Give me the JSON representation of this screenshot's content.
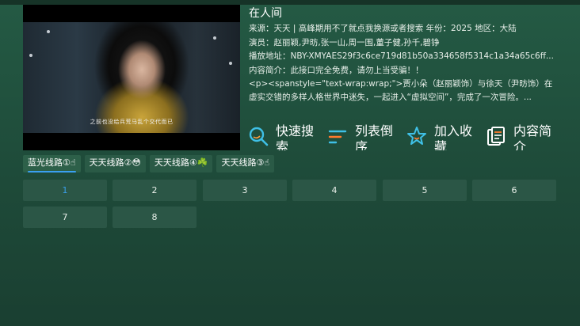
{
  "player": {
    "subtitle": "之前也没给兵荒马乱个交代而已"
  },
  "detail": {
    "title": "在人间",
    "source_line": "来源：天天 | 高峰期用不了就点我换源或者搜索 年份：2025 地区：大陆",
    "actors_line": "演员：赵丽颖,尹昉,张一山,周一围,董子健,孙千,碧铮",
    "play_url_line": "播放地址：NBY-XMYAES29f3c6ce719d81b50a334658f5314c1a34a65c6ff...",
    "intro_line": "内容简介：此接口完全免费，请勿上当受骗！！",
    "description": "<p><spanstyle=\"text-wrap:wrap;\">贾小朵（赵丽颖饰）与徐天（尹昉饰）在虚实交错的多样人格世界中迷失，一起进入“虚拟空间”，完成了一次冒险。..."
  },
  "actions": [
    {
      "label": "快速搜索",
      "icon": "search-icon",
      "color": "#3fc0e6"
    },
    {
      "label": "列表倒序",
      "icon": "sort-list-icon",
      "color": "#3fc0e6"
    },
    {
      "label": "加入收藏",
      "icon": "star-icon",
      "color": "#3fc0e6"
    },
    {
      "label": "内容简介",
      "icon": "document-icon",
      "color": "#ffffff"
    }
  ],
  "lines": [
    {
      "label": "蓝光线路①☝",
      "active": true
    },
    {
      "label": "天天线路②😳",
      "active": false
    },
    {
      "label": "天天线路④☘️",
      "active": false
    },
    {
      "label": "天天线路③☝",
      "active": false
    }
  ],
  "episodes": [
    "1",
    "2",
    "3",
    "4",
    "5",
    "6",
    "7",
    "8"
  ],
  "colors": {
    "background": "#1f4d3b",
    "accent": "#3aa0f0",
    "tile": "#2b5646"
  }
}
